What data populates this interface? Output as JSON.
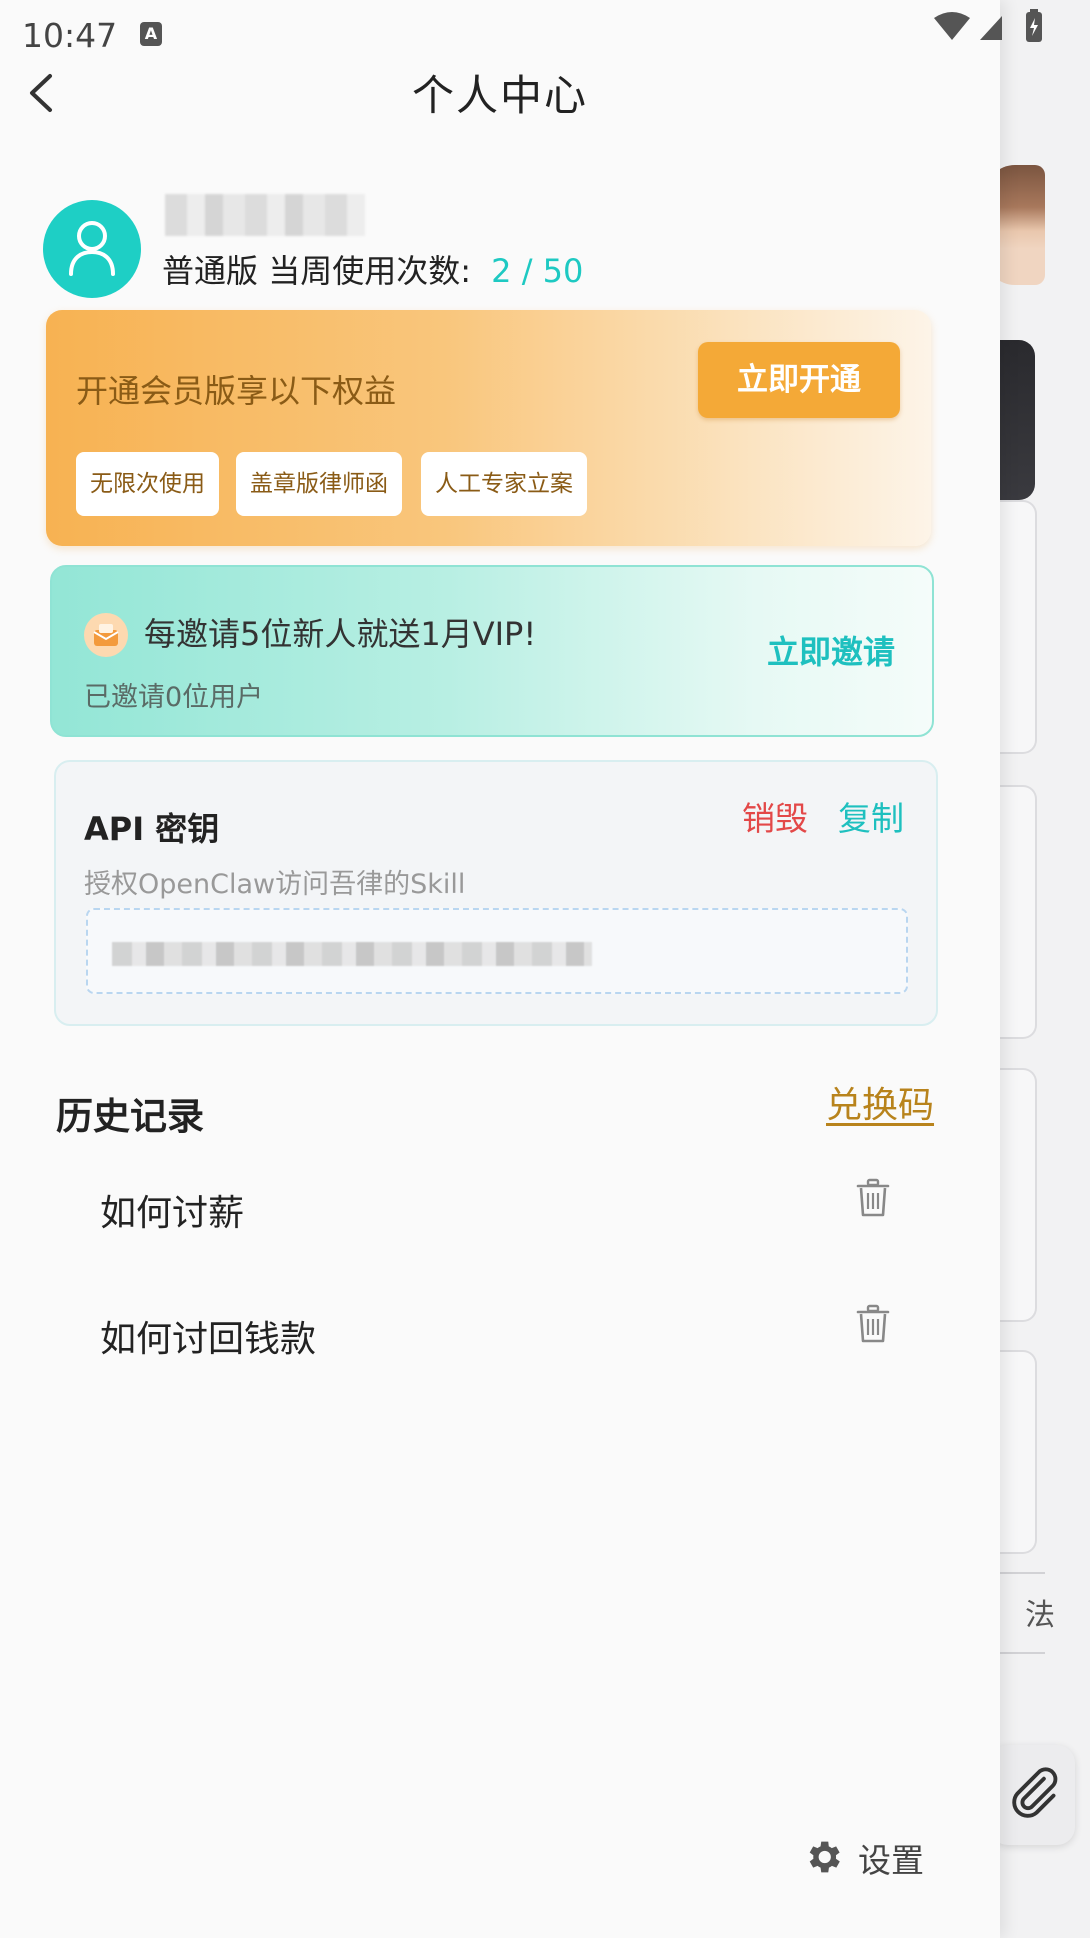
{
  "status_bar": {
    "time": "10:47",
    "input_indicator": "A"
  },
  "header": {
    "title": "个人中心",
    "back_icon": "chevron-left-icon"
  },
  "profile": {
    "plan": "普通版",
    "usage_label": "当周使用次数:",
    "usage_count": "2 / 50"
  },
  "vip": {
    "title": "开通会员版享以下权益",
    "button": "立即开通",
    "benefits": [
      "无限次使用",
      "盖章版律师函",
      "人工专家立案"
    ]
  },
  "invite": {
    "text": "每邀请5位新人就送1月VIP!",
    "sub": "已邀请0位用户",
    "button": "立即邀请"
  },
  "api": {
    "title": "API 密钥",
    "revoke": "销毁",
    "copy": "复制",
    "desc": "授权OpenClaw访问吾律的Skill"
  },
  "history": {
    "title": "历史记录",
    "redeem": "兑换码",
    "items": [
      {
        "label": "如何讨薪"
      },
      {
        "label": "如何讨回钱款"
      }
    ]
  },
  "settings": {
    "label": "设置"
  },
  "background_app": {
    "glyph": "法"
  },
  "colors": {
    "accent_teal": "#1ec9c2",
    "vip_orange": "#f4a937",
    "danger_red": "#e34848",
    "link_gold": "#b8831c"
  }
}
